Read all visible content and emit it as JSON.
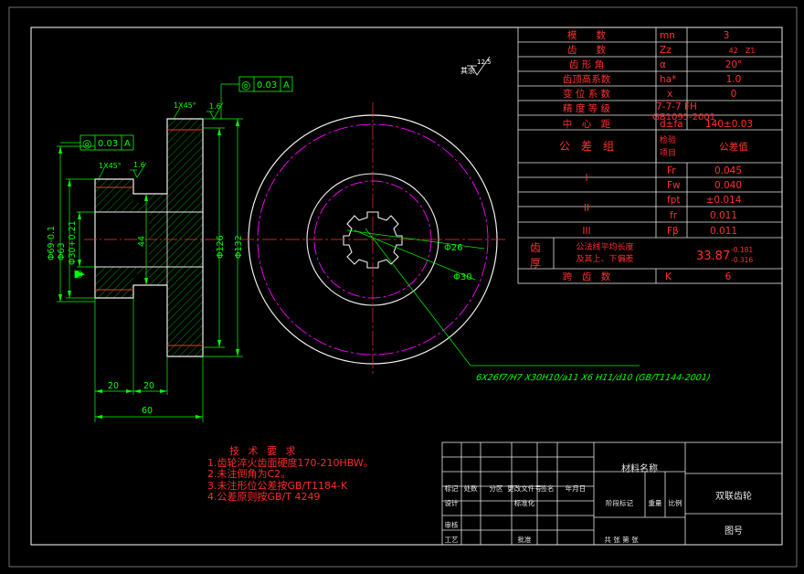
{
  "colors": {
    "background": "#000000",
    "frame": "#ffffff",
    "table_text": "#ff3030",
    "dimension": "#00ff00",
    "centerline": "#ff3030",
    "hatch": "#00ff00",
    "pitch_circle": "#ff00ff"
  },
  "params": [
    {
      "name": "模　　数",
      "sym": "mn",
      "val": "3"
    },
    {
      "name": "齿　　数",
      "sym": "Zz",
      "val": "42　Z1"
    },
    {
      "name": "齿 形 角",
      "sym": "α",
      "val": "20°"
    },
    {
      "name": "齿顶高系数",
      "sym": "ha*",
      "val": "1.0"
    },
    {
      "name": "变 位 系 数",
      "sym": "x",
      "val": "0"
    },
    {
      "name": "精 度 等 级",
      "sym": "7-7-7 FH",
      "val": ""
    },
    {
      "name": "中　心　距",
      "sym": "d±fa",
      "val": "140±0.03"
    }
  ],
  "std_label": "GB1095-2001",
  "tol_header": {
    "group": "公　差　组",
    "item": "检验项目",
    "value": "公差值"
  },
  "tol_rows": [
    {
      "grp": "I",
      "sym": "Fr",
      "val": "0.045"
    },
    {
      "grp": "",
      "sym": "Fw",
      "val": "0.040"
    },
    {
      "grp": "II",
      "sym": "fpt",
      "val": "±0.014"
    },
    {
      "grp": "",
      "sym": "fr",
      "val": "0.011"
    },
    {
      "grp": "III",
      "sym": "Fβ",
      "val": "0.011"
    }
  ],
  "thickness": {
    "label": "齿厚",
    "desc1": "公法线平均长度",
    "desc2": "及其上、下偏差",
    "val": "33.87",
    "up": "-0.181",
    "dn": "-0.316"
  },
  "span": {
    "name": "跨　齿　数",
    "sym": "K",
    "val": "6"
  },
  "fcf_top": {
    "sym": "◎",
    "tol": "0.03",
    "datum": "A"
  },
  "fcf_left": {
    "sym": "◎",
    "tol": "0.03",
    "datum": "A"
  },
  "roughness_top": "1.6",
  "roughness_left": "1.6",
  "roughness_rest": "12.5",
  "rest_label": "其余",
  "chamfer_top": "1X45°",
  "chamfer_left": "1X45°",
  "dims": {
    "d69": "Φ69-0.1",
    "d63": "Φ63",
    "d30": "Φ30+0.21",
    "d44": "44",
    "d126": "Φ126",
    "d132": "Φ132",
    "w20a": "20",
    "w20b": "20",
    "w60": "60",
    "r26": "Φ26",
    "r30": "Φ30"
  },
  "spline_note": "6X26f7/H7 X30H10/a11 X6 H11/d10 (GB/T1144-2001)",
  "tech_req": {
    "title": "技 术 要 求",
    "items": [
      "1.齿轮淬火齿面硬度170-210HBW。",
      "2.未注倒角为C2。",
      "3.未注形位公差按GB/T1184-K",
      "4.公差原则按GB/T 4249"
    ]
  },
  "title_block": {
    "material": "材料名称",
    "part_name": "双联齿轮",
    "drawing_no": "图号",
    "stage": "阶段标记",
    "weight": "重量",
    "scale": "比例",
    "sheet": "共 张 第 张",
    "mark": "标记",
    "count": "处数",
    "zone": "分区",
    "doc": "更改文件号",
    "sign": "签名",
    "date": "年月日",
    "designer": "设计",
    "standard": "标准化",
    "checker": "审核",
    "process": "工艺",
    "approve": "批准"
  }
}
